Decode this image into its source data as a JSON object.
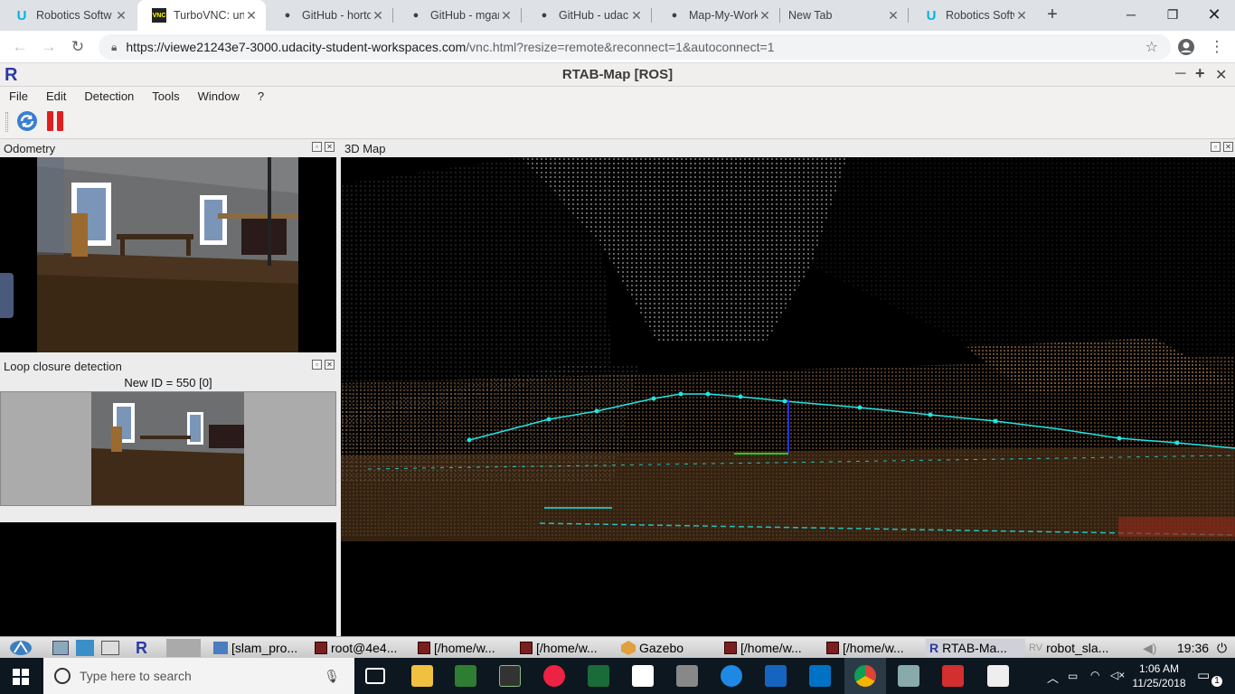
{
  "browser": {
    "tabs": [
      {
        "title": "Robotics Softw",
        "icon": "udacity-icon",
        "active": false
      },
      {
        "title": "TurboVNC: un",
        "icon": "vnc-icon",
        "active": true
      },
      {
        "title": "GitHub - horto",
        "icon": "github-icon",
        "active": false
      },
      {
        "title": "GitHub - mgar",
        "icon": "github-icon",
        "active": false
      },
      {
        "title": "GitHub - udac",
        "icon": "github-icon",
        "active": false
      },
      {
        "title": "Map-My-Work",
        "icon": "github-icon",
        "active": false
      },
      {
        "title": "New Tab",
        "icon": "",
        "active": false
      },
      {
        "title": "Robotics Softw",
        "icon": "udacity-icon",
        "active": false
      }
    ],
    "url_host": "https://viewe21243e7-3000.udacity-student-workspaces.com",
    "url_path": "/vnc.html?resize=remote&reconnect=1&autoconnect=1"
  },
  "app": {
    "title": "RTAB-Map [ROS]",
    "logo": "R",
    "menu": [
      "File",
      "Edit",
      "Detection",
      "Tools",
      "Window",
      "?"
    ],
    "odometry_label": "Odometry",
    "loop_label": "Loop closure detection",
    "new_id_text": "New ID = 550 [0]",
    "map3d_label": "3D Map",
    "colors": {
      "trajectory": "#22e5e5",
      "accent": "#2b3aa3"
    }
  },
  "vnc_taskbar": {
    "items": [
      "[slam_pro...",
      "root@4e4...",
      "[/home/w...",
      "[/home/w...",
      "Gazebo",
      "[/home/w...",
      "[/home/w...",
      "RTAB-Ma...",
      "robot_sla..."
    ],
    "clock": "19:36",
    "logo": "R"
  },
  "windows_taskbar": {
    "search_placeholder": "Type here to search",
    "time": "1:06 AM",
    "date": "11/25/2018",
    "notifications": "1"
  }
}
